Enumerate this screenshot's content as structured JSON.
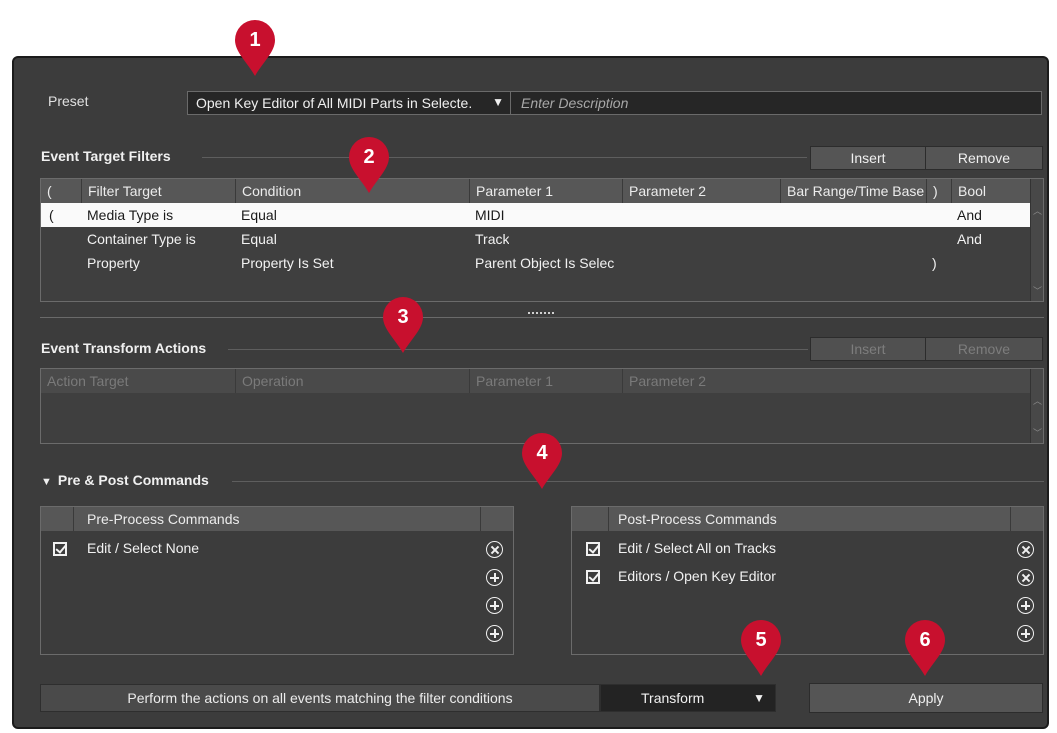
{
  "preset": {
    "label": "Preset",
    "value": "Open Key Editor of All MIDI Parts in Selecte.",
    "description_placeholder": "Enter Description"
  },
  "filters": {
    "title": "Event Target Filters",
    "insert_label": "Insert",
    "remove_label": "Remove",
    "columns": [
      "(",
      "Filter Target",
      "Condition",
      "Parameter 1",
      "Parameter 2",
      "Bar Range/Time Base",
      ")",
      "Bool"
    ],
    "rows": [
      {
        "open": "(",
        "target": "Media Type is",
        "condition": "Equal",
        "param1": "MIDI",
        "param2": "",
        "range": "",
        "close": "",
        "bool": "And"
      },
      {
        "open": "",
        "target": "Container Type is",
        "condition": "Equal",
        "param1": "Track",
        "param2": "",
        "range": "",
        "close": "",
        "bool": "And"
      },
      {
        "open": "",
        "target": "Property",
        "condition": "Property Is Set",
        "param1": "Parent Object Is Selec",
        "param2": "",
        "range": "",
        "close": ")",
        "bool": ""
      }
    ]
  },
  "actions": {
    "title": "Event Transform Actions",
    "insert_label": "Insert",
    "remove_label": "Remove",
    "columns": [
      "Action Target",
      "Operation",
      "Parameter 1",
      "Parameter 2"
    ]
  },
  "prepost": {
    "title": "Pre & Post Commands",
    "pre_header": "Pre-Process Commands",
    "post_header": "Post-Process Commands",
    "pre_items": [
      {
        "label": "Edit / Select None",
        "checked": true
      }
    ],
    "post_items": [
      {
        "label": "Edit / Select All on Tracks",
        "checked": true
      },
      {
        "label": "Editors / Open Key Editor",
        "checked": true
      }
    ]
  },
  "footer": {
    "perform_text": "Perform the actions on all events matching the filter conditions",
    "mode_value": "Transform",
    "apply_label": "Apply"
  },
  "callouts": [
    "1",
    "2",
    "3",
    "4",
    "5",
    "6"
  ],
  "colors": {
    "marker": "#c8102e",
    "window": "#3c3c3c",
    "selected_row": "#fafafa"
  }
}
